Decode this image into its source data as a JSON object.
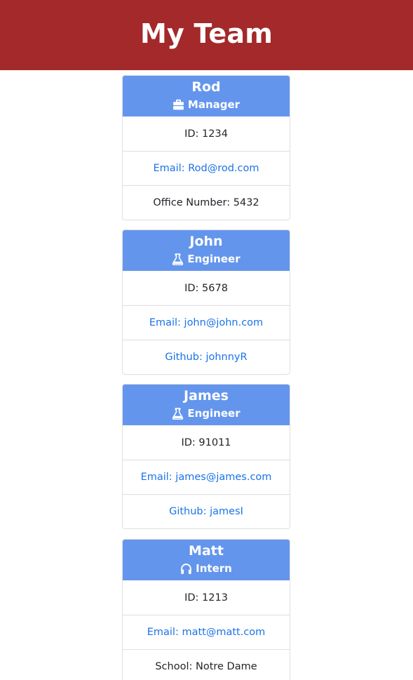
{
  "header": {
    "title": "My Team"
  },
  "team": [
    {
      "name": "Rod",
      "role": "Manager",
      "role_icon": "briefcase-icon",
      "id": "ID: 1234",
      "email": "Email: Rod@rod.com",
      "extra": "Office Number: 5432",
      "extra_is_link": false
    },
    {
      "name": "John",
      "role": "Engineer",
      "role_icon": "flask-icon",
      "id": "ID: 5678",
      "email": "Email: john@john.com",
      "extra": "Github: johnnyR",
      "extra_is_link": true
    },
    {
      "name": "James",
      "role": "Engineer",
      "role_icon": "flask-icon",
      "id": "ID: 91011",
      "email": "Email: james@james.com",
      "extra": "Github: jamesI",
      "extra_is_link": true
    },
    {
      "name": "Matt",
      "role": "Intern",
      "role_icon": "headphones-icon",
      "id": "ID: 1213",
      "email": "Email: matt@matt.com",
      "extra": "School: Notre Dame",
      "extra_is_link": false
    }
  ]
}
